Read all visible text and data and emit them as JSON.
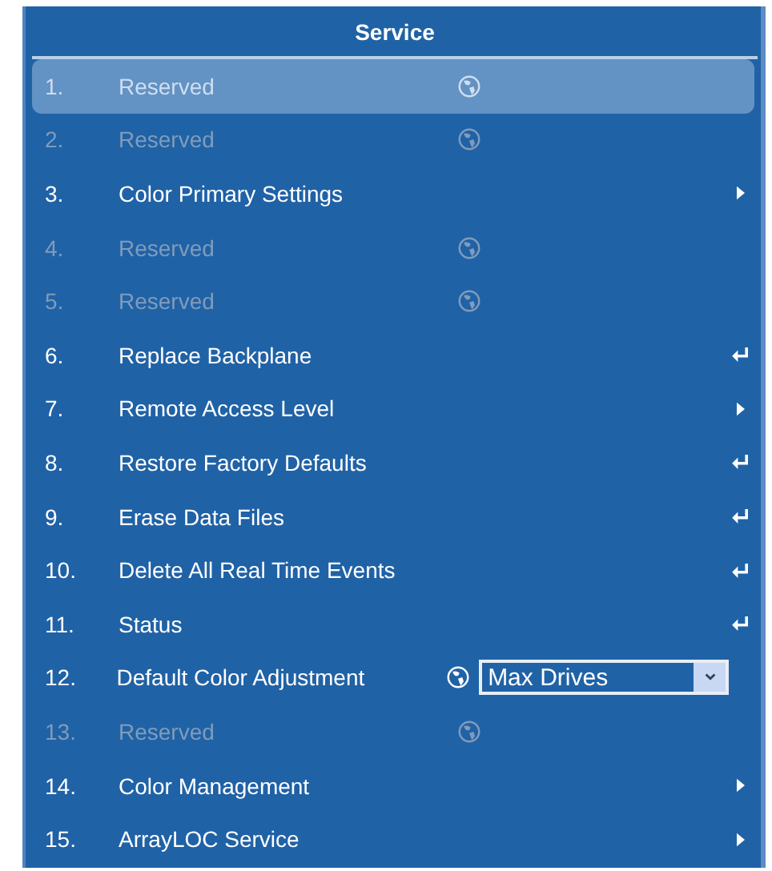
{
  "title": "Service",
  "rows": [
    {
      "number": "1.",
      "label": "Reserved",
      "disabled": true,
      "selected": true,
      "globe": true,
      "kind": "plain"
    },
    {
      "number": "2.",
      "label": "Reserved",
      "disabled": true,
      "selected": false,
      "globe": true,
      "kind": "plain"
    },
    {
      "number": "3.",
      "label": "Color Primary Settings",
      "disabled": false,
      "selected": false,
      "globe": false,
      "kind": "submenu"
    },
    {
      "number": "4.",
      "label": "Reserved",
      "disabled": true,
      "selected": false,
      "globe": true,
      "kind": "plain"
    },
    {
      "number": "5.",
      "label": "Reserved",
      "disabled": true,
      "selected": false,
      "globe": true,
      "kind": "plain"
    },
    {
      "number": "6.",
      "label": "Replace Backplane",
      "disabled": false,
      "selected": false,
      "globe": false,
      "kind": "action"
    },
    {
      "number": "7.",
      "label": "Remote Access Level",
      "disabled": false,
      "selected": false,
      "globe": false,
      "kind": "submenu"
    },
    {
      "number": "8.",
      "label": "Restore Factory Defaults",
      "disabled": false,
      "selected": false,
      "globe": false,
      "kind": "action"
    },
    {
      "number": "9.",
      "label": "Erase Data Files",
      "disabled": false,
      "selected": false,
      "globe": false,
      "kind": "action"
    },
    {
      "number": "10.",
      "label": "Delete All Real Time Events",
      "disabled": false,
      "selected": false,
      "globe": false,
      "kind": "action"
    },
    {
      "number": "11.",
      "label": "Status",
      "disabled": false,
      "selected": false,
      "globe": false,
      "kind": "action"
    },
    {
      "number": "12.",
      "label": "Default Color Adjustment",
      "disabled": false,
      "selected": false,
      "globe": true,
      "kind": "select",
      "value": "Max Drives"
    },
    {
      "number": "13.",
      "label": "Reserved",
      "disabled": true,
      "selected": false,
      "globe": true,
      "kind": "plain"
    },
    {
      "number": "14.",
      "label": "Color Management",
      "disabled": false,
      "selected": false,
      "globe": false,
      "kind": "submenu"
    },
    {
      "number": "15.",
      "label": "ArrayLOC Service",
      "disabled": false,
      "selected": false,
      "globe": false,
      "kind": "submenu"
    }
  ]
}
